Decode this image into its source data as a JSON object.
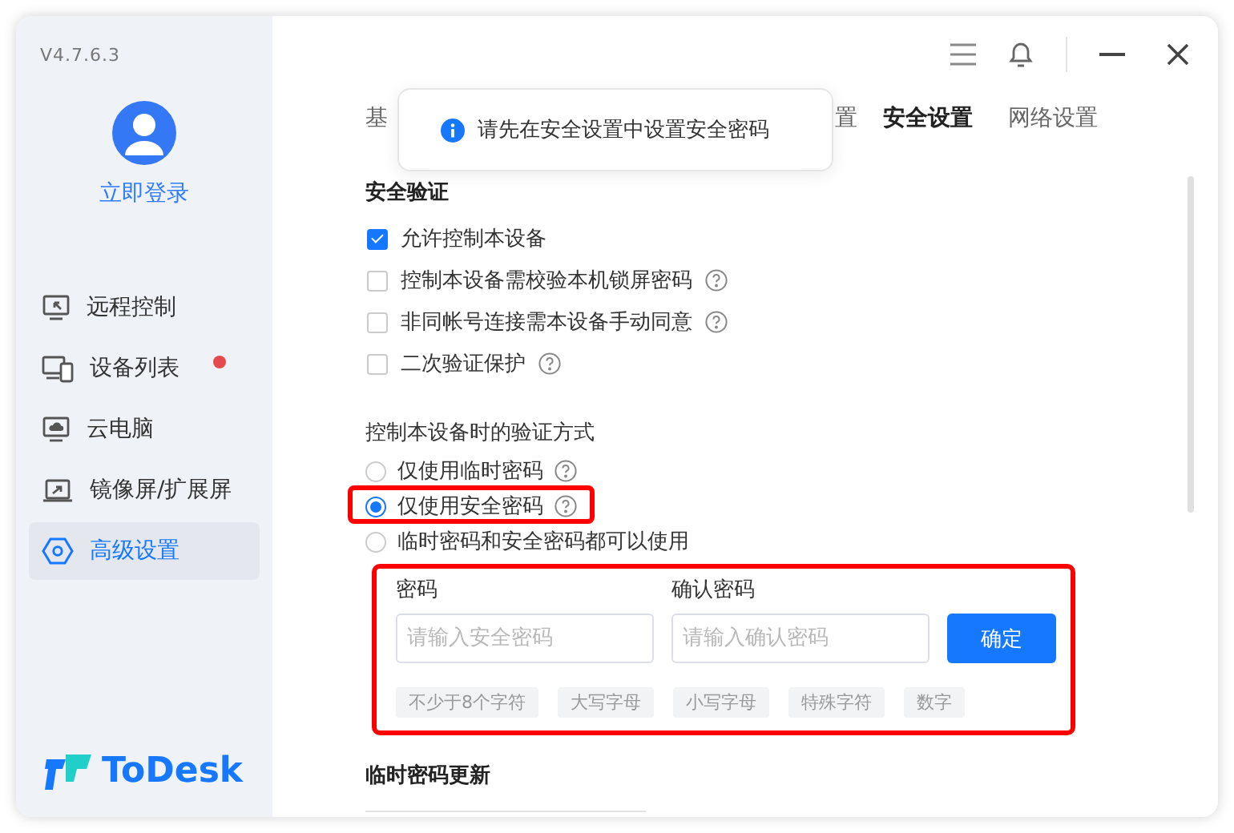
{
  "app": {
    "version": "V4.7.6.3",
    "login": "立即登录",
    "logo": "ToDesk"
  },
  "sidebar": {
    "items": [
      {
        "label": "远程控制",
        "kind": "remote",
        "selected": false,
        "notification_dot": false
      },
      {
        "label": "设备列表",
        "kind": "devices",
        "selected": false,
        "notification_dot": true
      },
      {
        "label": "云电脑",
        "kind": "cloud",
        "selected": false,
        "notification_dot": false
      },
      {
        "label": "镜像屏/扩展屏",
        "kind": "mirror",
        "selected": false,
        "notification_dot": false
      },
      {
        "label": "高级设置",
        "kind": "settings",
        "selected": true,
        "notification_dot": false
      }
    ]
  },
  "tabs": [
    {
      "label": "基",
      "selected": false
    },
    {
      "label": "置",
      "selected": false
    },
    {
      "label": "安全设置",
      "selected": true
    },
    {
      "label": "网络设置",
      "selected": false
    }
  ],
  "toast": {
    "text": "请先在安全设置中设置安全密码"
  },
  "security_verification": {
    "title": "安全验证",
    "options": [
      {
        "label": "允许控制本设备",
        "checked": true,
        "help": false
      },
      {
        "label": "控制本设备需校验本机锁屏密码",
        "checked": false,
        "help": true
      },
      {
        "label": "非同帐号连接需本设备手动同意",
        "checked": false,
        "help": true
      },
      {
        "label": "二次验证保护",
        "checked": false,
        "help": true
      }
    ]
  },
  "verification_method": {
    "title": "控制本设备时的验证方式",
    "options": [
      {
        "label": "仅使用临时密码",
        "selected": false,
        "help": true,
        "highlighted": false
      },
      {
        "label": "仅使用安全密码",
        "selected": true,
        "help": true,
        "highlighted": true
      },
      {
        "label": "临时密码和安全密码都可以使用",
        "selected": false,
        "help": false,
        "highlighted": false
      }
    ]
  },
  "password_form": {
    "highlighted": true,
    "fields": [
      {
        "label": "密码",
        "placeholder": "请输入安全密码"
      },
      {
        "label": "确认密码",
        "placeholder": "请输入确认密码"
      }
    ],
    "submit": "确定",
    "requirements": [
      "不少于8个字符",
      "大写字母",
      "小写字母",
      "特殊字符",
      "数字"
    ]
  },
  "temp_password": {
    "title": "临时密码更新"
  }
}
